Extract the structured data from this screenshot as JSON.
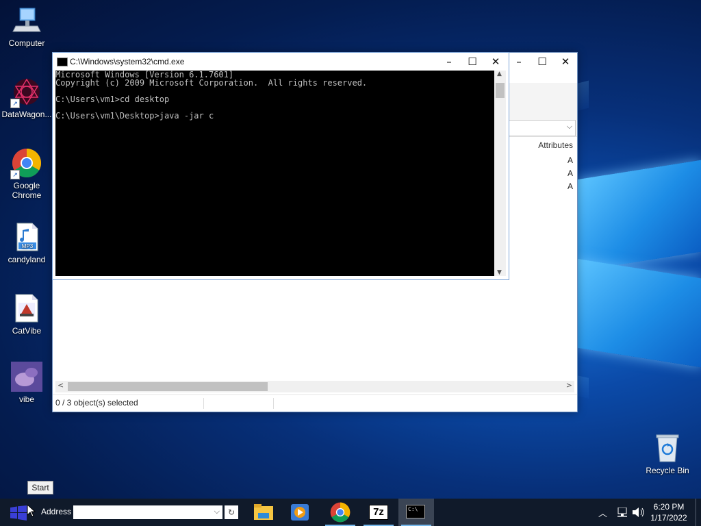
{
  "desktop": {
    "icons": [
      {
        "label": "Computer",
        "icon": "computer-icon"
      },
      {
        "label": "DataWagon...",
        "icon": "datawagon-icon"
      },
      {
        "label": "Google Chrome",
        "icon": "chrome-icon"
      },
      {
        "label": "candyland",
        "icon": "mp3-file-icon",
        "badge": "MP3"
      },
      {
        "label": "CatVibe",
        "icon": "java-file-icon"
      },
      {
        "label": "vibe",
        "icon": "image-file-icon"
      },
      {
        "label": "Recycle Bin",
        "icon": "recycle-bin-icon"
      }
    ]
  },
  "explorer": {
    "column_header": "Attributes",
    "attribute_values": [
      "A",
      "A",
      "A"
    ],
    "status_text": "0 / 3 object(s) selected"
  },
  "cmd": {
    "title": "C:\\Windows\\system32\\cmd.exe",
    "lines": [
      "Microsoft Windows [Version 6.1.7601]",
      "Copyright (c) 2009 Microsoft Corporation.  All rights reserved.",
      "",
      "C:\\Users\\vm1>cd desktop",
      "",
      "C:\\Users\\vm1\\Desktop>java -jar c"
    ]
  },
  "taskbar": {
    "start_tooltip": "Start",
    "address_label": "Address",
    "address_value": "",
    "pinned": [
      "file-explorer-icon",
      "media-player-icon",
      "chrome-icon",
      "7zip-icon",
      "cmd-icon"
    ],
    "sevenzip_label": "7z",
    "cmd_label": "C:\\",
    "clock_time": "6:20 PM",
    "clock_date": "1/17/2022"
  },
  "colors": {
    "taskbar": "#101a2a",
    "console_bg": "#000000",
    "console_fg": "#c0c0c0"
  }
}
